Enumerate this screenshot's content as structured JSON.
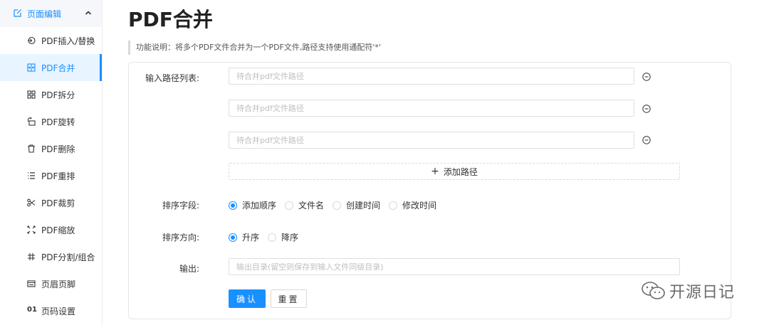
{
  "sidebar": {
    "group": {
      "label": "页面编辑",
      "icon": "edit-icon"
    },
    "items": [
      {
        "label": "PDF插入/替换",
        "icon": "insert-replace-icon"
      },
      {
        "label": "PDF合并",
        "icon": "merge-icon",
        "active": true
      },
      {
        "label": "PDF拆分",
        "icon": "split-icon"
      },
      {
        "label": "PDF旋转",
        "icon": "rotate-icon"
      },
      {
        "label": "PDF删除",
        "icon": "trash-icon"
      },
      {
        "label": "PDF重排",
        "icon": "list-icon"
      },
      {
        "label": "PDF裁剪",
        "icon": "scissors-icon"
      },
      {
        "label": "PDF缩放",
        "icon": "scale-icon"
      },
      {
        "label": "PDF分割/组合",
        "icon": "grid-icon"
      },
      {
        "label": "页眉页脚",
        "icon": "header-footer-icon"
      },
      {
        "label": "页码设置",
        "icon_text": "01"
      }
    ]
  },
  "main": {
    "title": "PDF合并",
    "description": "功能说明：将多个PDF文件合并为一个PDF文件,路径支持使用通配符'*'",
    "form": {
      "path_list_label": "输入路径列表:",
      "paths": [
        {
          "value": "",
          "placeholder": "待合并pdf文件路径"
        },
        {
          "value": "",
          "placeholder": "待合并pdf文件路径"
        },
        {
          "value": "",
          "placeholder": "待合并pdf文件路径"
        }
      ],
      "add_path_label": "添加路径",
      "sort_field_label": "排序字段:",
      "sort_fields": [
        "添加顺序",
        "文件名",
        "创建时间",
        "修改时间"
      ],
      "sort_field_selected": "添加顺序",
      "sort_dir_label": "排序方向:",
      "sort_dirs": [
        "升序",
        "降序"
      ],
      "sort_dir_selected": "升序",
      "output_label": "输出:",
      "output": {
        "value": "",
        "placeholder": "输出目录(留空则保存到输入文件同级目录)"
      },
      "confirm_label": "确认",
      "reset_label": "重置"
    }
  },
  "watermark": {
    "text": "开源日记",
    "icon": "wechat-icon"
  },
  "colors": {
    "accent": "#1890ff",
    "active_bg": "#e8f4ff",
    "border": "#dcdfe6"
  }
}
